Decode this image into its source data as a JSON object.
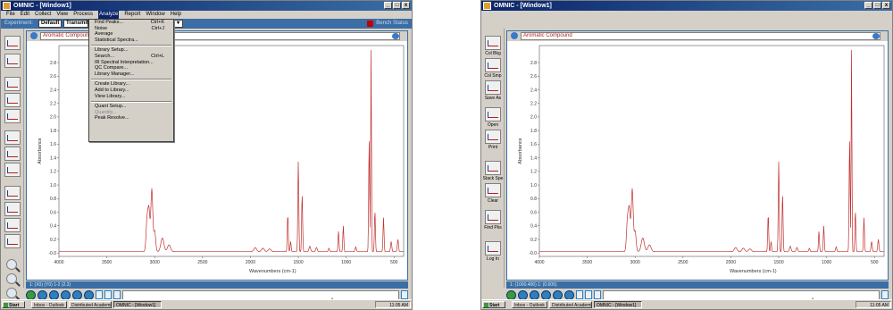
{
  "left": {
    "title": "OMNIC - [Window1]",
    "menu": [
      "File",
      "Edit",
      "Collect",
      "View",
      "Process",
      "Analyze",
      "Report",
      "Window",
      "Help"
    ],
    "active_menu": "Analyze",
    "toolbar": {
      "label_left": "Experiment:",
      "experiment": "Default",
      "mode": "Transmit",
      "status": "Bench Status"
    },
    "spectrum_title": "Aromatic Compound",
    "status_strip": "1: (X0) (Y0) 1-2 (2.3)",
    "analyze_menu": [
      {
        "label": "Find Peaks...",
        "shortcut": "Ctrl+K",
        "disabled": false
      },
      {
        "label": "Noise",
        "shortcut": "Ctrl+J",
        "disabled": false
      },
      {
        "label": "Average",
        "shortcut": "",
        "disabled": false
      },
      {
        "label": "Statistical Spectra...",
        "shortcut": "",
        "disabled": false
      },
      {
        "sep": true
      },
      {
        "label": "Library Setup...",
        "shortcut": "",
        "disabled": false
      },
      {
        "label": "Search...",
        "shortcut": "Ctrl+L",
        "disabled": false
      },
      {
        "label": "IR Spectral Interpretation...",
        "shortcut": "",
        "disabled": false
      },
      {
        "label": "QC Compare...",
        "shortcut": "",
        "disabled": false
      },
      {
        "label": "Library Manager...",
        "shortcut": "",
        "disabled": false
      },
      {
        "sep": true
      },
      {
        "label": "Create Library...",
        "shortcut": "",
        "disabled": false
      },
      {
        "label": "Add to Library...",
        "shortcut": "",
        "disabled": false
      },
      {
        "label": "View Library...",
        "shortcut": "",
        "disabled": false
      },
      {
        "sep": true
      },
      {
        "label": "Quant Setup...",
        "shortcut": "",
        "disabled": false
      },
      {
        "label": "Quantify...",
        "shortcut": "",
        "disabled": true
      },
      {
        "label": "Peak Resolve...",
        "shortcut": "",
        "disabled": false
      }
    ]
  },
  "right": {
    "title": "OMNIC - [Window1]",
    "spectrum_title": "Aromatic Compound",
    "status_strip": "1: (1000.406) 1: (0.605)",
    "toolbar_buttons": [
      {
        "label": "Col Bkg",
        "icon": "collect-background-icon"
      },
      {
        "label": "Col Smp",
        "icon": "collect-sample-icon"
      },
      {
        "label": "Save As",
        "icon": "save-as-icon"
      },
      {
        "label": "Open",
        "icon": "open-icon"
      },
      {
        "label": "Print",
        "icon": "print-icon"
      },
      {
        "label": "Stack Spe",
        "icon": "stack-spectra-icon"
      },
      {
        "label": "Clear",
        "icon": "clear-icon"
      },
      {
        "label": "Find Pks",
        "icon": "find-peaks-icon"
      },
      {
        "label": "Log In",
        "icon": "log-in-icon"
      }
    ]
  },
  "taskbar": {
    "start": "Start",
    "tasks": [
      "Inbox - Outlook",
      "Distributed Academic",
      "OMNIC - [Window1]"
    ],
    "clock": "11:05 AM"
  },
  "colors": {
    "titlebar": "#0a246a",
    "spectrum": "#c03030",
    "accent": "#3a6ea5"
  },
  "chart_data": {
    "type": "line",
    "title": "Aromatic Compound",
    "xlabel": "Wavenumbers (cm-1)",
    "ylabel": "Absorbance",
    "xlim": [
      4000,
      400
    ],
    "ylim": [
      -0.05,
      3.05
    ],
    "x_ticks": [
      4000,
      3500,
      3000,
      2500,
      2000,
      1500,
      1000,
      500
    ],
    "y_ticks": [
      -0.0,
      0.2,
      0.4,
      0.6,
      0.8,
      1.0,
      1.2,
      1.4,
      1.6,
      1.8,
      2.0,
      2.2,
      2.4,
      2.6,
      2.8
    ],
    "baseline": 0.02,
    "peaks": [
      {
        "x": 3080,
        "y": 0.45,
        "w": 10
      },
      {
        "x": 3060,
        "y": 0.6,
        "w": 10
      },
      {
        "x": 3030,
        "y": 0.92,
        "w": 10
      },
      {
        "x": 3000,
        "y": 0.3,
        "w": 10
      },
      {
        "x": 2920,
        "y": 0.2,
        "w": 16
      },
      {
        "x": 2850,
        "y": 0.1,
        "w": 16
      },
      {
        "x": 1950,
        "y": 0.06,
        "w": 14
      },
      {
        "x": 1870,
        "y": 0.05,
        "w": 14
      },
      {
        "x": 1800,
        "y": 0.04,
        "w": 14
      },
      {
        "x": 1610,
        "y": 0.55,
        "w": 5
      },
      {
        "x": 1580,
        "y": 0.15,
        "w": 5
      },
      {
        "x": 1500,
        "y": 1.33,
        "w": 5
      },
      {
        "x": 1460,
        "y": 0.85,
        "w": 5
      },
      {
        "x": 1380,
        "y": 0.08,
        "w": 8
      },
      {
        "x": 1310,
        "y": 0.06,
        "w": 8
      },
      {
        "x": 1180,
        "y": 0.05,
        "w": 6
      },
      {
        "x": 1080,
        "y": 0.3,
        "w": 5
      },
      {
        "x": 1030,
        "y": 0.38,
        "w": 5
      },
      {
        "x": 900,
        "y": 0.07,
        "w": 6
      },
      {
        "x": 760,
        "y": 1.65,
        "w": 5
      },
      {
        "x": 740,
        "y": 2.98,
        "w": 4
      },
      {
        "x": 700,
        "y": 0.6,
        "w": 5
      },
      {
        "x": 610,
        "y": 0.5,
        "w": 5
      },
      {
        "x": 530,
        "y": 0.15,
        "w": 6
      },
      {
        "x": 460,
        "y": 0.18,
        "w": 6
      }
    ]
  }
}
